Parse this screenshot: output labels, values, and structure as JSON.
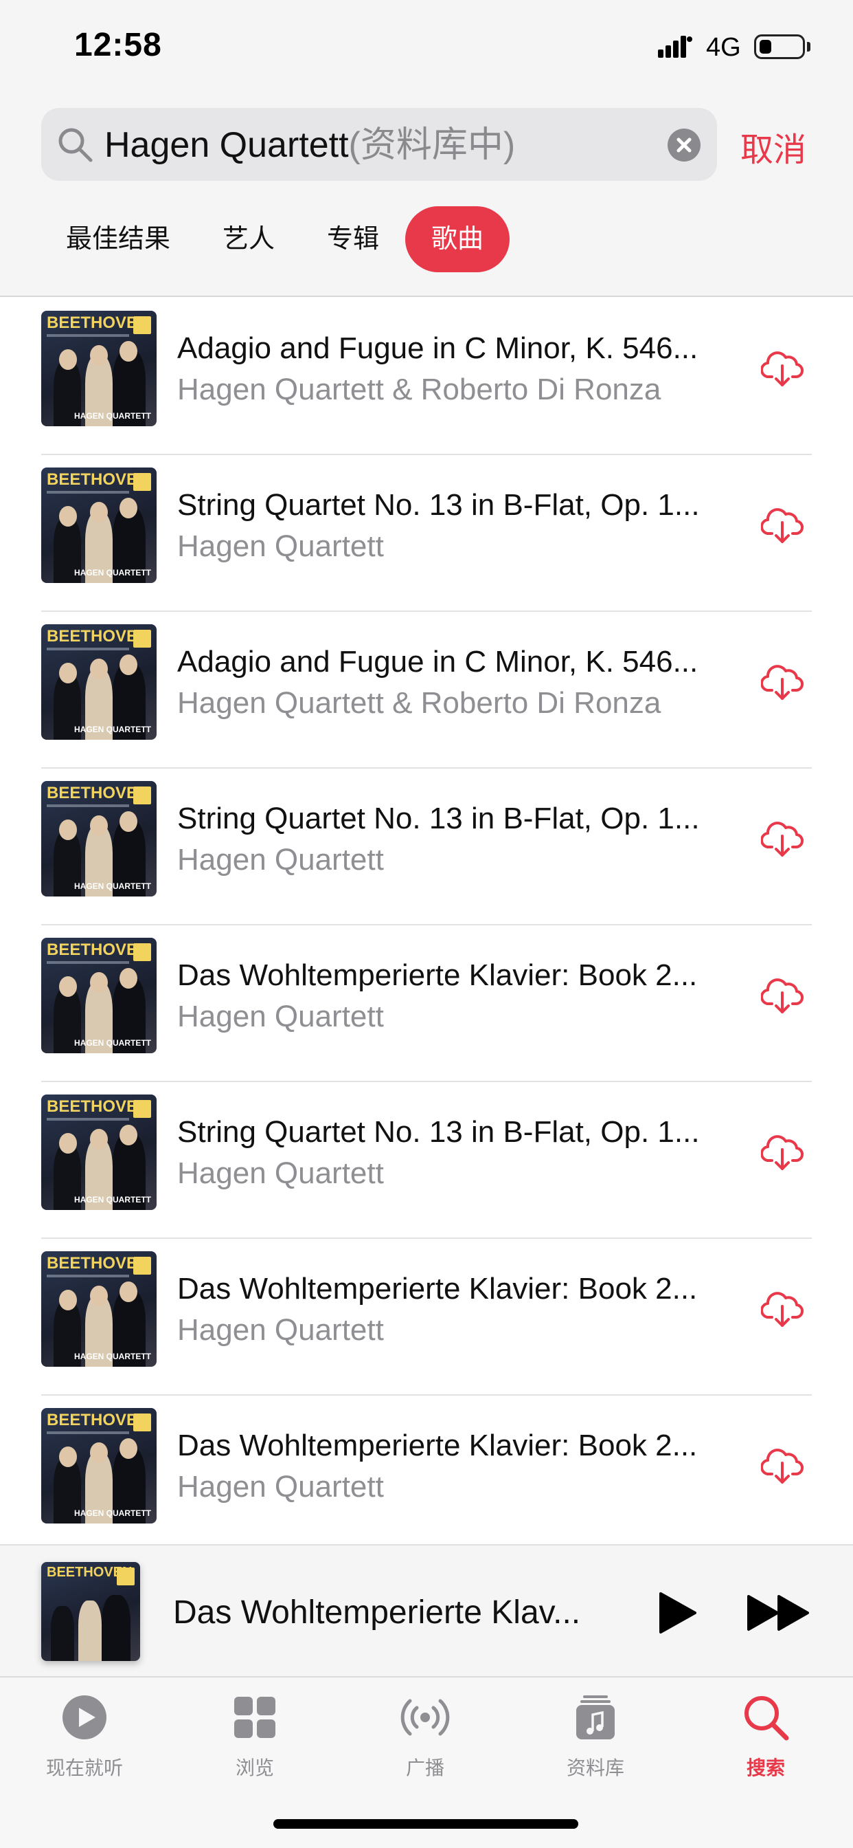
{
  "status_bar": {
    "time": "12:58",
    "network": "4G",
    "battery_level": 0.3
  },
  "search": {
    "query": "Hagen Quartett",
    "scope": "(资料库中)",
    "cancel_label": "取消"
  },
  "filter_tabs": [
    {
      "label": "最佳结果",
      "active": false
    },
    {
      "label": "艺人",
      "active": false
    },
    {
      "label": "专辑",
      "active": false
    },
    {
      "label": "歌曲",
      "active": true
    }
  ],
  "artwork": {
    "title": "BEETHOVEN",
    "band": "HAGEN QUARTETT"
  },
  "songs": [
    {
      "title": "Adagio and Fugue in C Minor, K. 546...",
      "artist": "Hagen Quartett & Roberto Di Ronza"
    },
    {
      "title": "String Quartet No. 13 in B-Flat, Op. 1...",
      "artist": "Hagen Quartett"
    },
    {
      "title": "Adagio and Fugue in C Minor, K. 546...",
      "artist": "Hagen Quartett & Roberto Di Ronza"
    },
    {
      "title": "String Quartet No. 13 in B-Flat, Op. 1...",
      "artist": "Hagen Quartett"
    },
    {
      "title": "Das Wohltemperierte Klavier: Book 2...",
      "artist": "Hagen Quartett"
    },
    {
      "title": "String Quartet No. 13 in B-Flat, Op. 1...",
      "artist": "Hagen Quartett"
    },
    {
      "title": "Das Wohltemperierte Klavier: Book 2...",
      "artist": "Hagen Quartett"
    },
    {
      "title": "Das Wohltemperierte Klavier: Book 2...",
      "artist": "Hagen Quartett"
    }
  ],
  "now_playing": {
    "title": "Das Wohltemperierte Klav..."
  },
  "tab_bar": [
    {
      "label": "现在就听",
      "icon": "play-circle-icon",
      "active": false
    },
    {
      "label": "浏览",
      "icon": "grid-icon",
      "active": false
    },
    {
      "label": "广播",
      "icon": "radio-icon",
      "active": false
    },
    {
      "label": "资料库",
      "icon": "library-icon",
      "active": false
    },
    {
      "label": "搜索",
      "icon": "search-icon",
      "active": true
    }
  ],
  "colors": {
    "accent": "#e8394a",
    "secondary_text": "#8e8e93",
    "background": "#f5f5f5"
  }
}
